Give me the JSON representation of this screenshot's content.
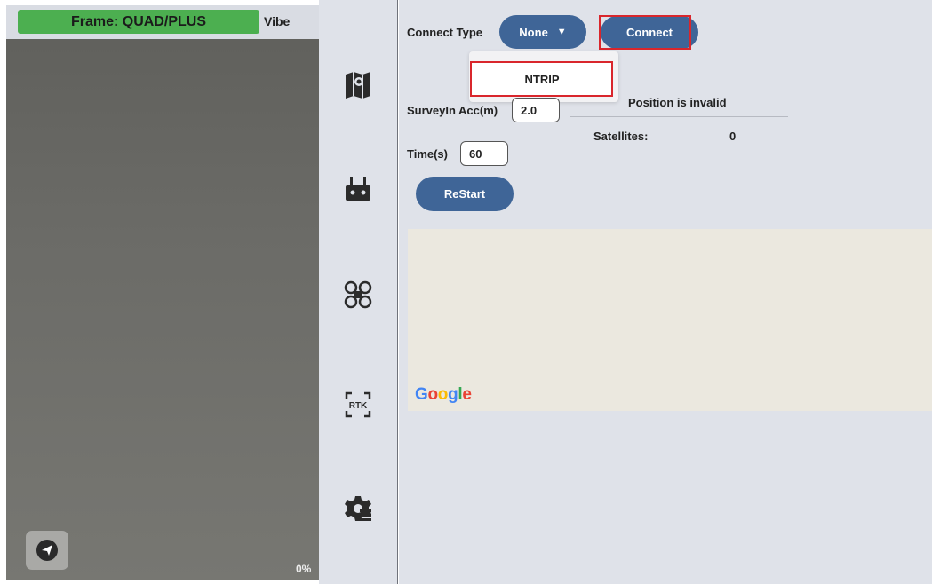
{
  "left_panel": {
    "frame_label": "Frame: QUAD/PLUS",
    "vibe_label": "Vibe",
    "progress_text": "0%",
    "send_icon": "paper-plane-icon"
  },
  "nav": {
    "items": [
      {
        "icon": "map-icon"
      },
      {
        "icon": "remote-controller-icon"
      },
      {
        "icon": "drone-icon"
      },
      {
        "icon": "rtk-icon",
        "label": "RTK"
      },
      {
        "icon": "gear-settings-icon"
      }
    ]
  },
  "rtk": {
    "connect_type_label": "Connect Type",
    "connect_type_value": "None",
    "dropdown_arrow": "▼",
    "connect_button": "Connect",
    "dropdown_options": [
      "NTRIP"
    ],
    "survey_acc_label": "SurveyIn Acc(m)",
    "survey_acc_value": "2.0",
    "time_label": "Time(s)",
    "time_value": "60",
    "restart_button": "ReStart",
    "position_status": "Position is invalid",
    "satellites_label": "Satellites:",
    "satellites_value": "0"
  },
  "map": {
    "logo_letters": [
      "G",
      "o",
      "o",
      "g",
      "l",
      "e"
    ]
  },
  "colors": {
    "frame_green": "#4caf50",
    "button_blue": "#3f6597",
    "highlight_red": "#d9262c",
    "map_bg": "#ebe8df",
    "google_blue": "#4285f4",
    "google_red": "#ea4335",
    "google_yellow": "#fbbc05",
    "google_green": "#34a853"
  }
}
